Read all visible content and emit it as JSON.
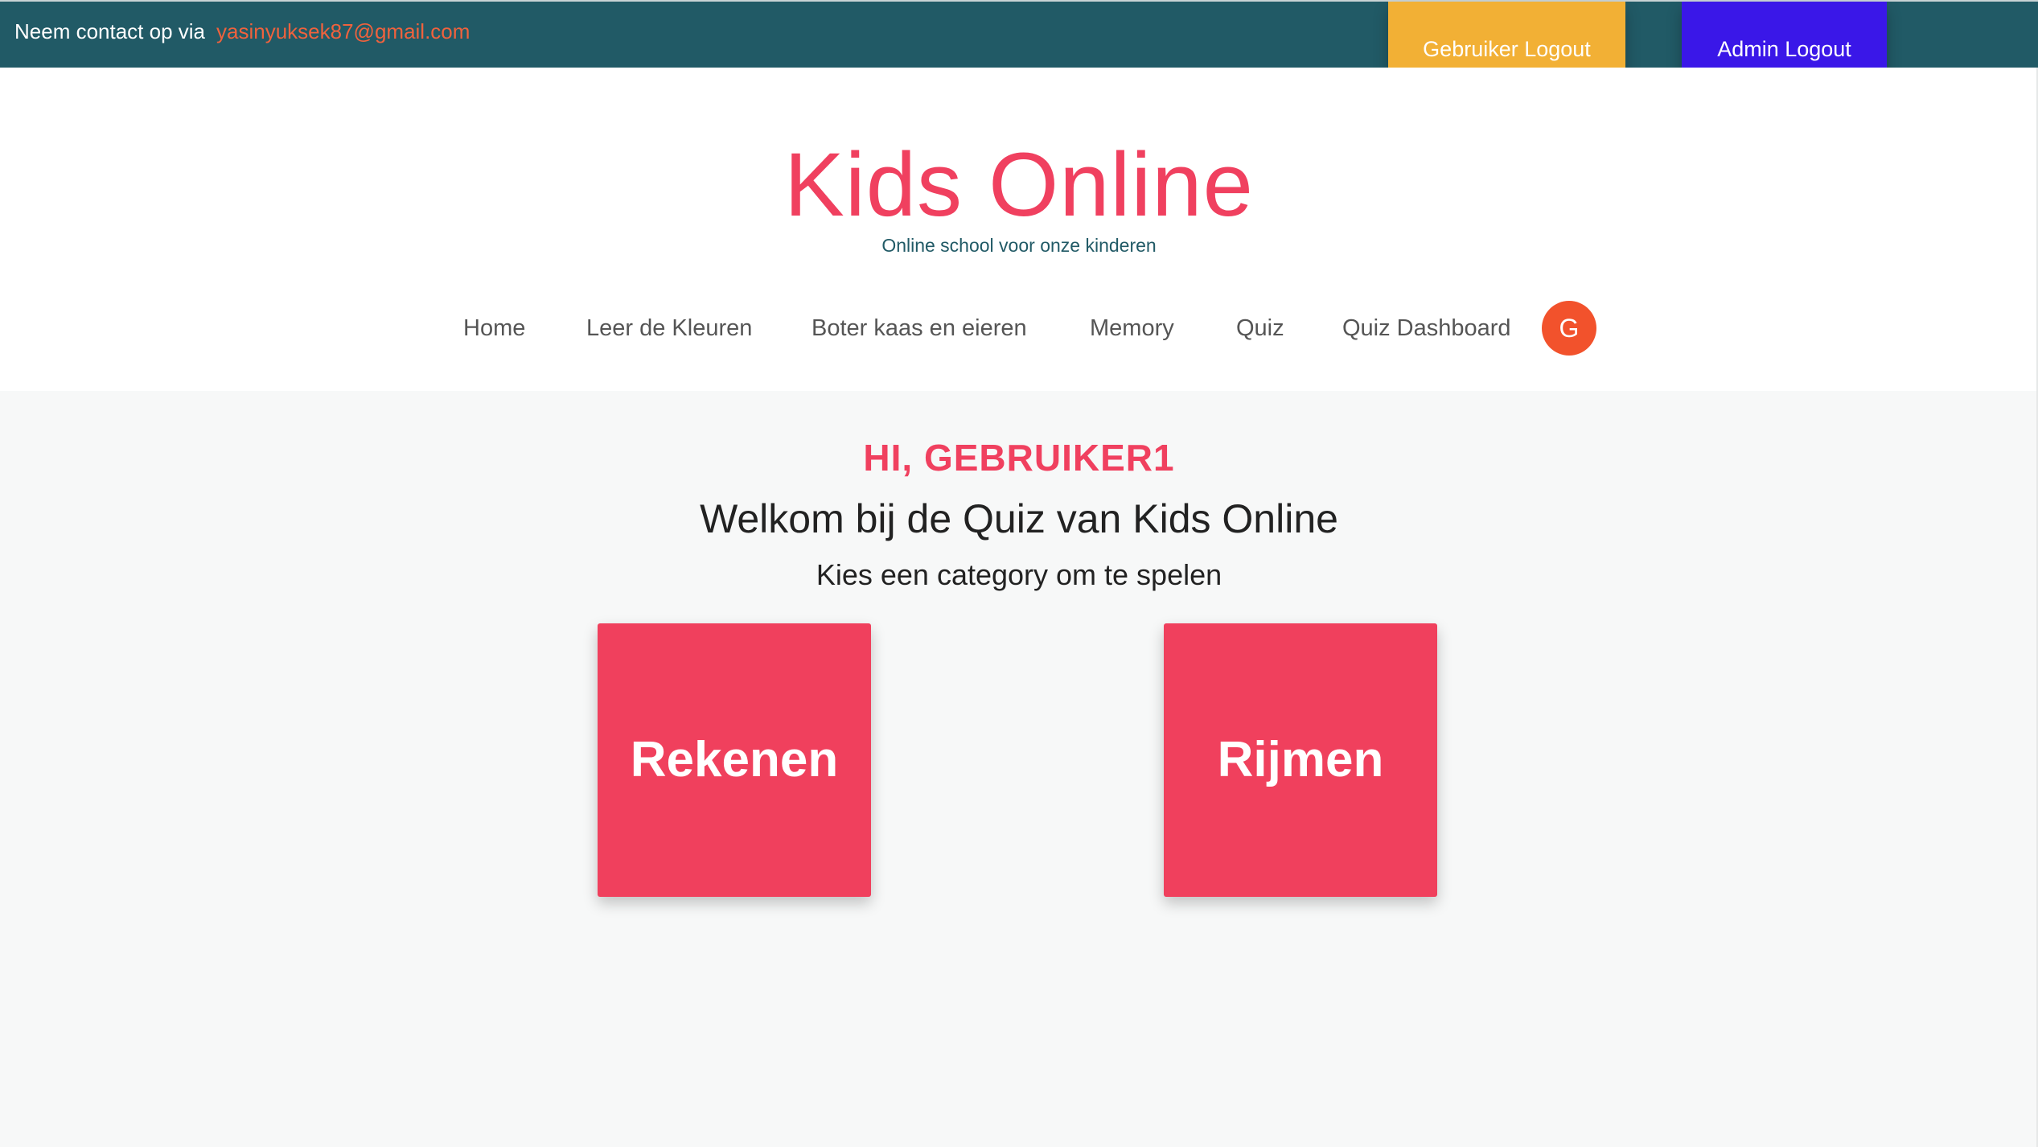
{
  "topbar": {
    "contact_text": "Neem contact op via",
    "email": "yasinyuksek87@gmail.com",
    "user_logout_label": "Gebruiker Logout",
    "admin_logout_label": "Admin Logout"
  },
  "header": {
    "brand": "Kids Online",
    "tagline": "Online school voor onze kinderen"
  },
  "nav": {
    "items": [
      {
        "label": "Home"
      },
      {
        "label": "Leer de Kleuren"
      },
      {
        "label": "Boter kaas en eieren"
      },
      {
        "label": "Memory"
      },
      {
        "label": "Quiz"
      },
      {
        "label": "Quiz Dashboard"
      }
    ],
    "avatar_initial": "G"
  },
  "main": {
    "greeting": "HI, GEBRUIKER1",
    "welcome": "Welkom bij de Quiz van Kids Online",
    "subtitle": "Kies een category om te spelen",
    "categories": [
      {
        "label": "Rekenen"
      },
      {
        "label": "Rijmen"
      }
    ]
  },
  "colors": {
    "topbar_bg": "#215a66",
    "accent_pink": "#f0405f",
    "email_orange": "#f0623d",
    "user_logout_bg": "#f2b035",
    "admin_logout_bg": "#3a17e8",
    "avatar_bg": "#f2522c"
  }
}
